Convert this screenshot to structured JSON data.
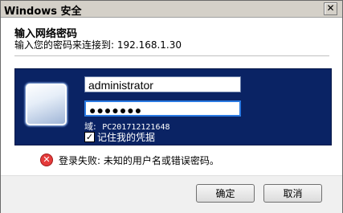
{
  "window": {
    "title": "Windows 安全",
    "close_glyph": "✕"
  },
  "header": {
    "heading": "输入网络密码",
    "subheading": "输入您的密码来连接到: 192.168.1.30"
  },
  "credentials": {
    "username": "administrator",
    "password_mask": "●●●●●●●",
    "domain_label": "域:",
    "domain_value": "PC201712121648",
    "remember_label": "记住我的凭据",
    "remember_checked": true
  },
  "error": {
    "icon": "error-icon",
    "message": "登录失败: 未知的用户名或错误密码。"
  },
  "buttons": {
    "ok": "确定",
    "cancel": "取消"
  }
}
